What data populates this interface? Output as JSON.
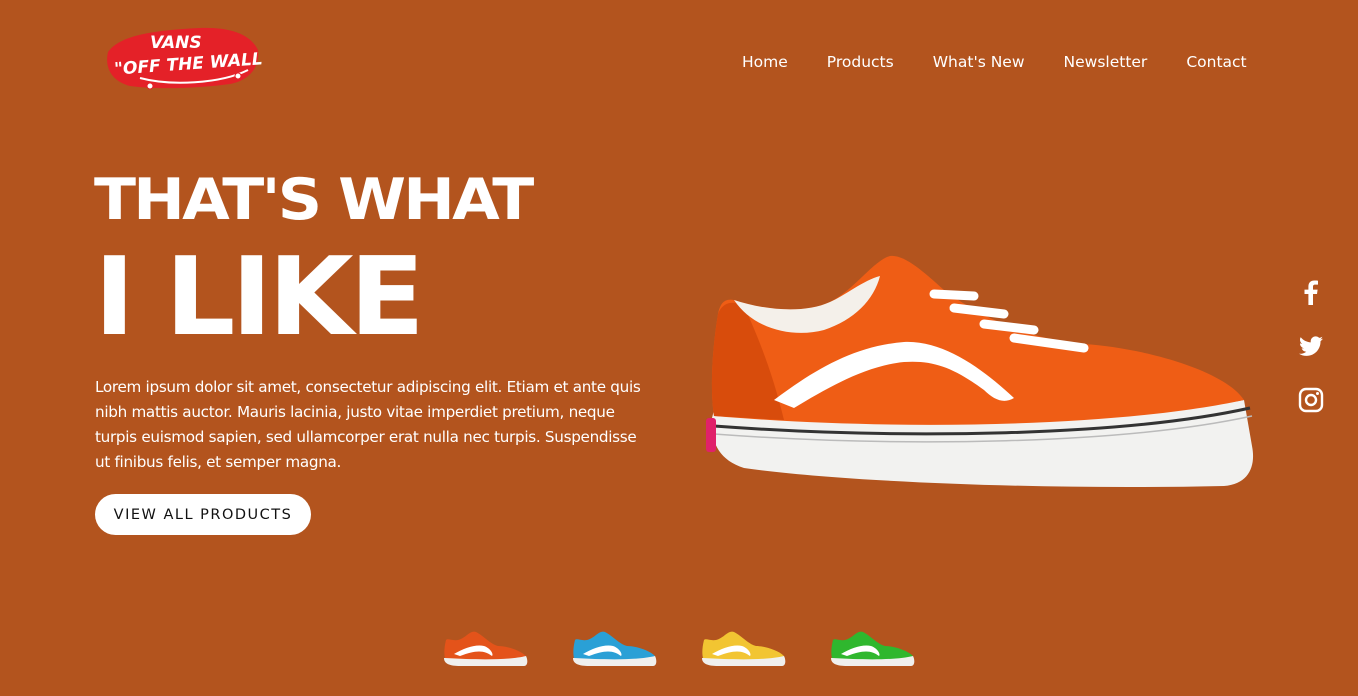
{
  "brand": {
    "logo_top_text": "VANS",
    "logo_main_text": "\"OFF THE WALL\"",
    "logo_color": "#e42128"
  },
  "nav": {
    "items": [
      {
        "label": "Home"
      },
      {
        "label": "Products"
      },
      {
        "label": "What's New"
      },
      {
        "label": "Newsletter"
      },
      {
        "label": "Contact"
      }
    ]
  },
  "hero": {
    "headline_line1": "THAT'S WHAT",
    "headline_line2": "I LIKE",
    "description": "Lorem ipsum dolor sit amet, consectetur adipiscing elit. Etiam et ante quis nibh mattis auctor. Mauris lacinia, justo vitae imperdiet pretium, neque turpis euismod sapien, sed ullamcorper erat nulla nec turpis. Suspendisse ut finibus felis, et semper magna.",
    "cta_label": "VIEW ALL PRODUCTS",
    "featured_shoe_color": "#ef5d15"
  },
  "social": [
    {
      "icon": "facebook-icon"
    },
    {
      "icon": "twitter-icon"
    },
    {
      "icon": "instagram-icon"
    }
  ],
  "colors": {
    "background": "#b3541e",
    "text": "#ffffff",
    "button_bg": "#ffffff",
    "button_text": "#111111"
  },
  "thumbnails": [
    {
      "color": "#e4531a",
      "name": "orange"
    },
    {
      "color": "#2aa0d6",
      "name": "blue"
    },
    {
      "color": "#f2c532",
      "name": "yellow"
    },
    {
      "color": "#2fb72e",
      "name": "green"
    }
  ]
}
